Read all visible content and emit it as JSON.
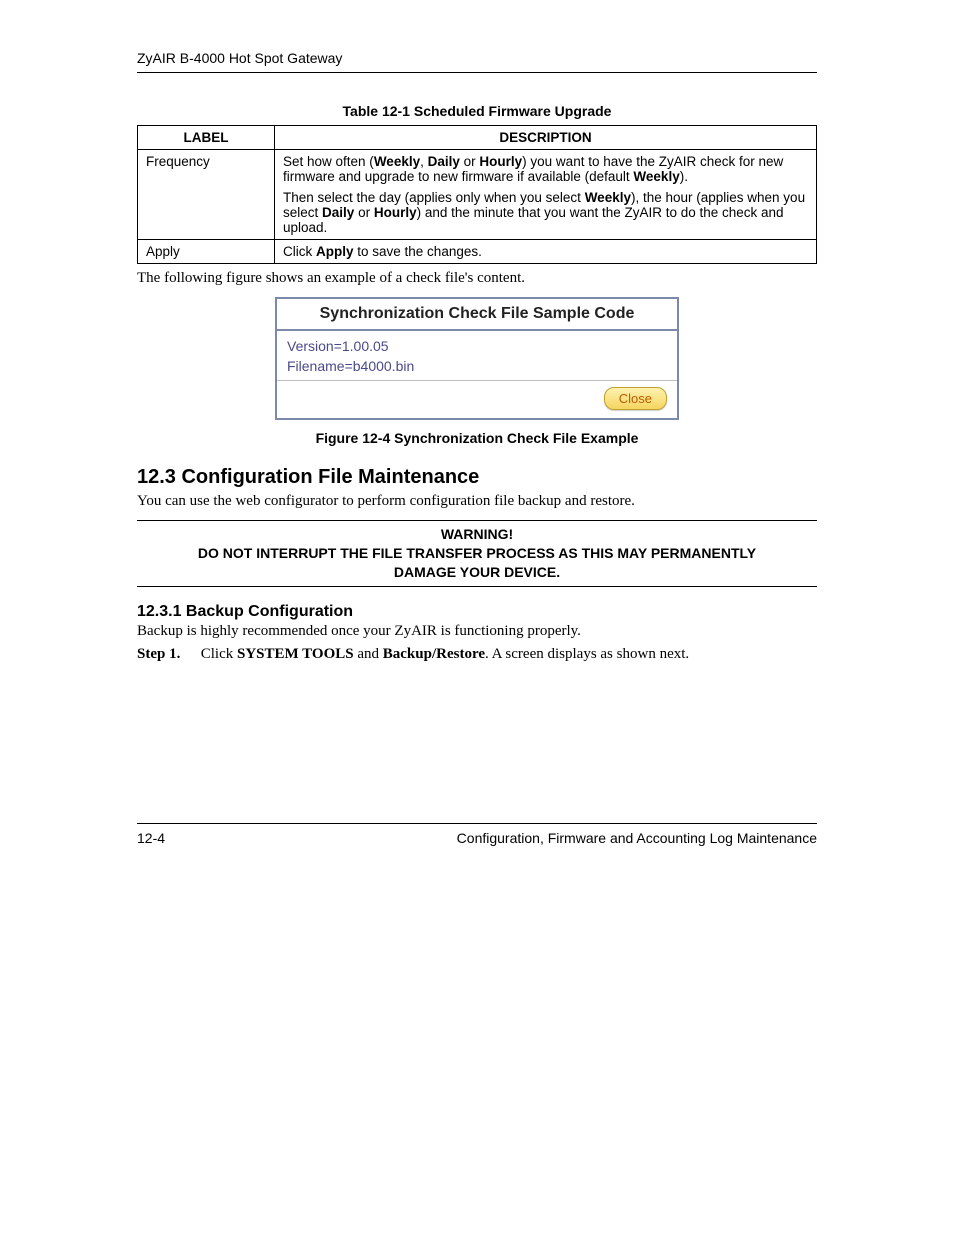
{
  "header": {
    "title": "ZyAIR B-4000 Hot Spot Gateway"
  },
  "table": {
    "caption": "Table 12-1 Scheduled Firmware Upgrade",
    "headers": {
      "label": "LABEL",
      "description": "DESCRIPTION"
    },
    "rows": [
      {
        "label": "Frequency",
        "desc_parts": {
          "p1a": "Set how often (",
          "p1b": "Weekly",
          "p1c": ", ",
          "p1d": "Daily",
          "p1e": " or ",
          "p1f": "Hourly",
          "p1g": ") you want to have the ZyAIR check for new firmware and upgrade to new firmware if available (default ",
          "p1h": "Weekly",
          "p1i": ").",
          "p2a": "Then select the day (applies only when you select ",
          "p2b": "Weekly",
          "p2c": "), the hour (applies when you select ",
          "p2d": "Daily",
          "p2e": " or ",
          "p2f": "Hourly",
          "p2g": ") and the minute that you want the ZyAIR to do the check and upload."
        }
      },
      {
        "label": "Apply",
        "desc_parts": {
          "a1": "Click ",
          "a2": "Apply",
          "a3": " to save the changes."
        }
      }
    ]
  },
  "intro_para": "The following figure shows an example of a check file's content.",
  "figure": {
    "title": "Synchronization Check File Sample Code",
    "line1": "Version=1.00.05",
    "line2": "Filename=b4000.bin",
    "close_label": "Close",
    "caption": "Figure 12-4 Synchronization Check File Example"
  },
  "section": {
    "heading": "12.3  Configuration File Maintenance",
    "para": "You can use the web configurator to perform configuration file backup and restore."
  },
  "warning": {
    "line1": "WARNING!",
    "line2": "DO NOT INTERRUPT THE FILE TRANSFER PROCESS AS THIS MAY PERMANENTLY DAMAGE YOUR DEVICE."
  },
  "subsection": {
    "heading": "12.3.1 Backup Configuration",
    "para": "Backup is highly recommended once your ZyAIR is functioning properly.",
    "step_label": "Step 1.",
    "step_parts": {
      "s1": "Click ",
      "s2": "SYSTEM TOOLS",
      "s3": " and ",
      "s4": "Backup/Restore",
      "s5": ". A screen displays as shown next."
    }
  },
  "footer": {
    "page_num": "12-4",
    "title": "Configuration, Firmware and Accounting Log Maintenance"
  }
}
